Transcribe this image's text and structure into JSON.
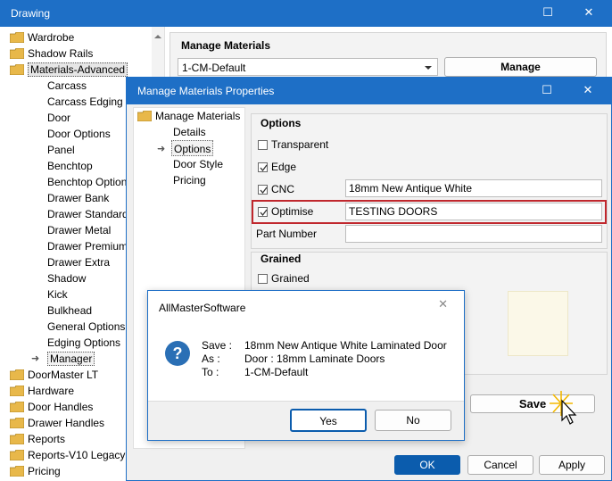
{
  "main_window": {
    "title": "Drawing",
    "tree": [
      {
        "label": "Wardrobe",
        "folder": true
      },
      {
        "label": "Shadow Rails",
        "folder": true
      },
      {
        "label": "Materials-Advanced",
        "folder": true,
        "selected": true
      },
      {
        "label": "Carcass"
      },
      {
        "label": "Carcass Edging"
      },
      {
        "label": "Door"
      },
      {
        "label": "Door Options"
      },
      {
        "label": "Panel"
      },
      {
        "label": "Benchtop"
      },
      {
        "label": "Benchtop Options"
      },
      {
        "label": "Drawer Bank"
      },
      {
        "label": "Drawer Standard"
      },
      {
        "label": "Drawer Metal"
      },
      {
        "label": "Drawer Premium"
      },
      {
        "label": "Drawer Extra"
      },
      {
        "label": "Shadow"
      },
      {
        "label": "Kick"
      },
      {
        "label": "Bulkhead"
      },
      {
        "label": "General Options"
      },
      {
        "label": "Edging Options"
      },
      {
        "label": "Manager",
        "current": true
      },
      {
        "label": "DoorMaster LT",
        "folder": true
      },
      {
        "label": "Hardware",
        "folder": true
      },
      {
        "label": "Door Handles",
        "folder": true
      },
      {
        "label": "Drawer Handles",
        "folder": true
      },
      {
        "label": "Reports",
        "folder": true
      },
      {
        "label": "Reports-V10 Legacy",
        "folder": true
      },
      {
        "label": "Pricing",
        "folder": true
      }
    ],
    "manage_materials": {
      "title": "Manage Materials",
      "dropdown_value": "1-CM-Default",
      "manage_button": "Manage"
    }
  },
  "properties_window": {
    "title": "Manage Materials Properties",
    "nav": {
      "root": "Manage Materials",
      "items": [
        "Details",
        "Options",
        "Door Style",
        "Pricing"
      ]
    },
    "options": {
      "title": "Options",
      "transparent": "Transparent",
      "edge": "Edge",
      "cnc": "CNC",
      "cnc_value": "18mm New Antique White",
      "optimise": "Optimise",
      "optimise_value": "TESTING DOORS",
      "part_number": "Part Number",
      "part_number_value": ""
    },
    "grained": {
      "title": "Grained",
      "grained": "Grained"
    },
    "save_button": "Save",
    "ok_button": "OK",
    "cancel_button": "Cancel",
    "apply_button": "Apply"
  },
  "message_box": {
    "title": "AllMasterSoftware",
    "rows": [
      {
        "label": "Save :",
        "value": "18mm New Antique White Laminated Door"
      },
      {
        "label": "As :",
        "value": "Door : 18mm Laminate Doors"
      },
      {
        "label": "To :",
        "value": "1-CM-Default"
      }
    ],
    "yes_button": "Yes",
    "no_button": "No"
  },
  "colors": {
    "accent": "#1e6fc6",
    "highlight_border": "#c0272d",
    "folder": "#e8b84a"
  },
  "icons": {
    "minimize": "–",
    "maximize": "☐",
    "close": "✕",
    "arrow": "➜"
  }
}
